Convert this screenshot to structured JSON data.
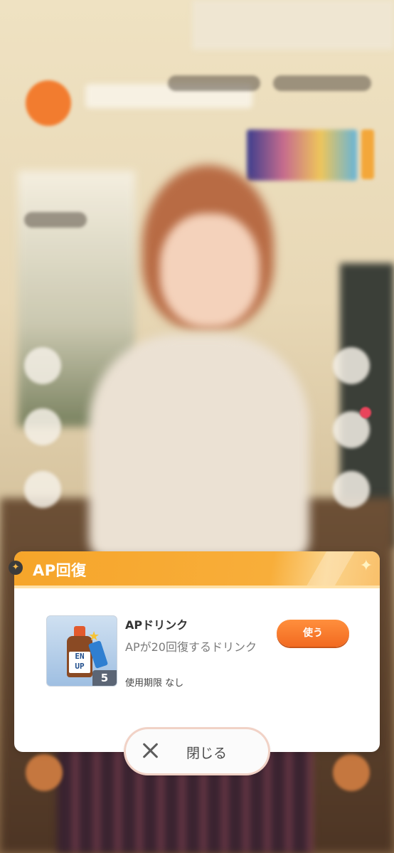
{
  "dialog": {
    "title": "AP回復",
    "item": {
      "name": "APドリンク",
      "description": "APが20回復するドリンク",
      "expiry": "使用期限 なし",
      "count": "5",
      "thumb_label": "EN UP"
    },
    "use_label": "使う",
    "close_label": "閉じる"
  },
  "colors": {
    "header": "#f6a52a",
    "use_button": "#f26a20"
  }
}
